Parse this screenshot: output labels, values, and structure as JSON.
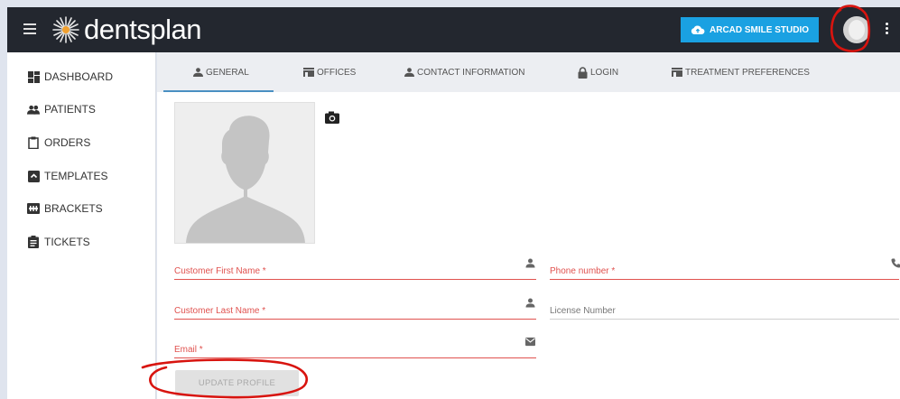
{
  "app": {
    "brand": "dentsplan",
    "logo_icon": "starburst-logo-icon"
  },
  "header": {
    "arcad_button": "ARCAD SMILE STUDIO",
    "arcad_icon": "cloud-upload-icon",
    "accent": "#1aa1e2"
  },
  "sidebar": {
    "items": [
      {
        "label": "DASHBOARD",
        "icon": "dashboard-icon"
      },
      {
        "label": "PATIENTS",
        "icon": "people-icon"
      },
      {
        "label": "ORDERS",
        "icon": "clipboard-icon"
      },
      {
        "label": "TEMPLATES",
        "icon": "template-icon"
      },
      {
        "label": "BRACKETS",
        "icon": "brackets-icon"
      },
      {
        "label": "TICKETS",
        "icon": "ticket-icon"
      }
    ]
  },
  "tabs": [
    {
      "label": "GENERAL",
      "icon": "person-icon",
      "active": true
    },
    {
      "label": "OFFICES",
      "icon": "store-icon"
    },
    {
      "label": "CONTACT INFORMATION",
      "icon": "person-icon"
    },
    {
      "label": "LOGIN",
      "icon": "lock-icon"
    },
    {
      "label": "TREATMENT PREFERENCES",
      "icon": "store-icon"
    }
  ],
  "form": {
    "first_name": {
      "placeholder": "Customer First Name *",
      "value": ""
    },
    "last_name": {
      "placeholder": "Customer Last Name *",
      "value": ""
    },
    "email": {
      "placeholder": "Email *",
      "value": ""
    },
    "phone": {
      "placeholder": "Phone number *",
      "value": ""
    },
    "license": {
      "placeholder": "License Number",
      "value": ""
    },
    "update_button": "UPDATE PROFILE"
  },
  "colors": {
    "required": "#e0524f",
    "topbar": "#23272f",
    "annotation": "#d8140f"
  }
}
